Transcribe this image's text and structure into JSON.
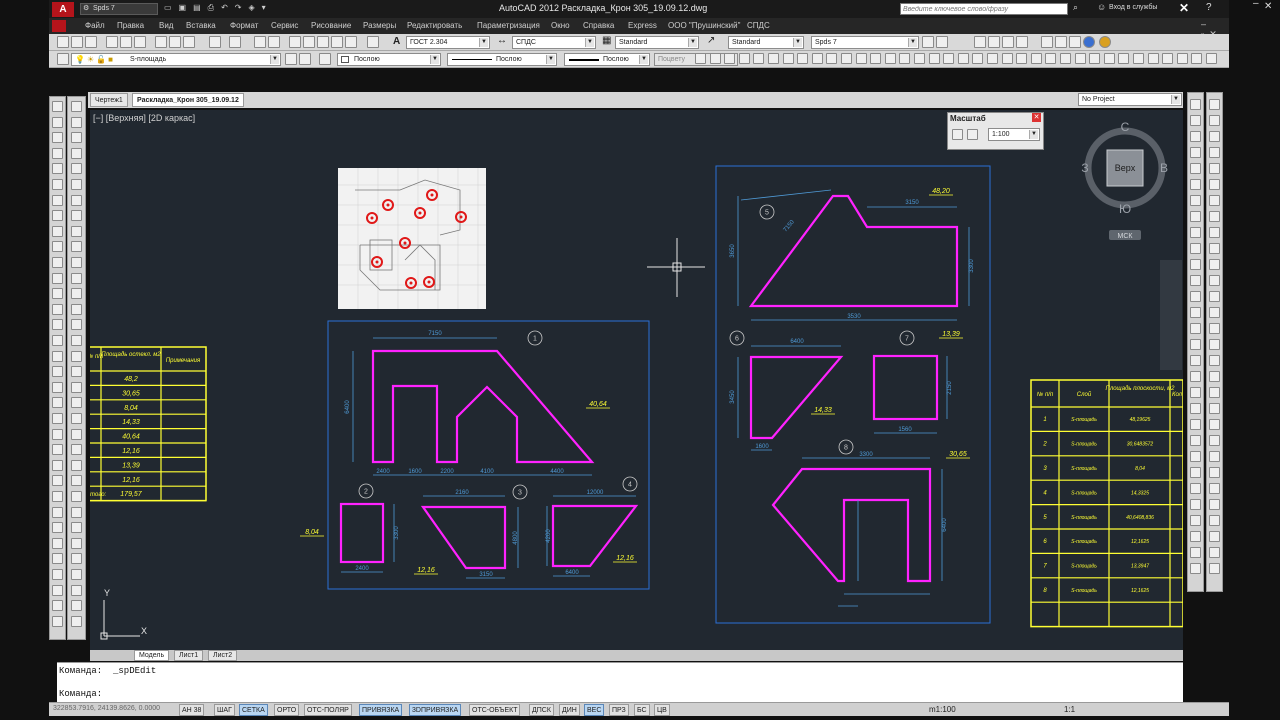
{
  "window": {
    "title": "AutoCAD 2012   Раскладка_Крон 305_19.09.12.dwg",
    "workspace": "Spds 7",
    "search_placeholder": "Введите ключевое слово/фразу",
    "signin": "Вход в службы"
  },
  "menu": [
    "Файл",
    "Правка",
    "Вид",
    "Вставка",
    "Формат",
    "Сервис",
    "Рисование",
    "Размеры",
    "Редактировать",
    "Параметризация",
    "Окно",
    "Справка",
    "Express",
    "ООО \"Прушинский\"",
    "СПДС"
  ],
  "toolbar": {
    "text_style": "ГОСТ 2.304",
    "dim_style": "СПДС",
    "table_style": "Standard",
    "mleader_style": "Standard",
    "visual_style": "Spds 7",
    "layer": "S-площадь",
    "color": "Послою",
    "linetype": "Послою",
    "lineweight": "Послою",
    "plotstyle": "Поцвету",
    "project": "No Project"
  },
  "tabs": [
    "Чертеж1",
    "Раскладка_Крон 305_19.09.12"
  ],
  "viewport_label": "[−] [Верхняя] [2D каркас]",
  "scale_panel": {
    "title": "Масштаб",
    "value": "1:100"
  },
  "viewcube": {
    "north": "С",
    "south": "Ю",
    "west": "З",
    "east": "В",
    "face": "Верх",
    "ucs": "МСК"
  },
  "layout_tabs": [
    "Модель",
    "Лист1",
    "Лист2"
  ],
  "command_history": "Команда:  _spDEdit",
  "command_prompt": "Команда:",
  "status": {
    "coords": "322853.7916, 24139.8626, 0.0000",
    "buttons": [
      "АН 38",
      "ШАГ",
      "СЕТКА",
      "ОРТО",
      "ОТС-ПОЛЯР",
      "ПРИВЯЗКА",
      "3DПРИВЯЗКА",
      "ОТС-ОБЪЕКТ",
      "ДПСК",
      "ДИН",
      "ВЕС",
      "ПРЗ",
      "БС",
      "ЦВ"
    ],
    "active_buttons": [
      "СЕТКА",
      "ПРИВЯЗКА",
      "3DПРИВЯЗКА",
      "ВЕС"
    ],
    "annot_scale": "m1:100",
    "zoom": "1:1"
  },
  "left_table": {
    "header": [
      "№ п/п",
      "Площадь остекл. м2",
      "Примечания"
    ],
    "rows": [
      "48,2",
      "30,65",
      "8,04",
      "14,33",
      "40,64",
      "12,16",
      "13,39",
      "12,16"
    ],
    "total_label": "Итого:",
    "total": "179,57"
  },
  "right_table": {
    "header": [
      "№ п/п",
      "Слой",
      "Площадь плоскости, м2",
      "Кол"
    ],
    "rows": [
      [
        "1",
        "S-площадь",
        "48,19625"
      ],
      [
        "2",
        "S-площадь",
        "30,6483572"
      ],
      [
        "3",
        "S-площадь",
        "8,04"
      ],
      [
        "4",
        "S-площадь",
        "14,3325"
      ],
      [
        "5",
        "S-площадь",
        "40,6408,836"
      ],
      [
        "6",
        "S-площадь",
        "12,1625"
      ],
      [
        "7",
        "S-площадь",
        "13,3947"
      ],
      [
        "8",
        "S-площадь",
        "12,1625"
      ]
    ]
  },
  "drawing": {
    "areas": {
      "a1": "40,64",
      "a2": "8,04",
      "a3": "12,16",
      "a4": "12,16",
      "a5": "48,20",
      "a6": "14,33",
      "a7": "13,39",
      "a8": "30,65"
    },
    "numbers": [
      "1",
      "2",
      "3",
      "4",
      "5",
      "6",
      "7",
      "8"
    ],
    "dims": {
      "d1": "7150",
      "d2": "6400",
      "d3": "2400",
      "d4": "1600",
      "d5": "2200",
      "d6": "4100",
      "d7": "4400",
      "d8": "2400",
      "d9": "3300",
      "d10": "2160",
      "d11": "4800",
      "d12": "3150",
      "d13": "12000",
      "d14": "4200",
      "d15": "6400",
      "d16": "3150",
      "d17": "3530",
      "d18": "3650",
      "d19": "3300",
      "d20": "7150",
      "d21": "6400",
      "d22": "3450",
      "d23": "1560",
      "d24": "2150",
      "d25": "1600",
      "d26": "3300",
      "d27": "6400"
    }
  },
  "colors": {
    "canvas": "#212830",
    "shape": "#ff22ff",
    "yellow": "#ffff33",
    "frame": "#2b6fd6",
    "dim": "#4f9ad6",
    "bubble": "#c9c9c9"
  }
}
